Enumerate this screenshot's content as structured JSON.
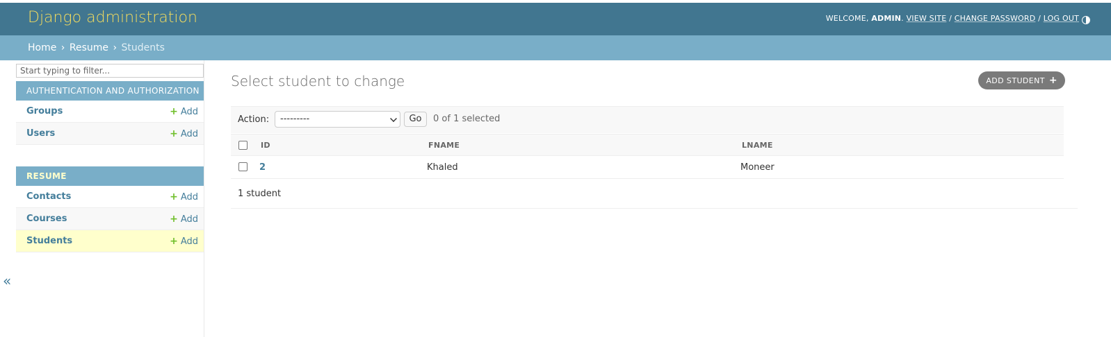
{
  "header": {
    "brand": "Django administration",
    "welcome": "WELCOME,",
    "username": "ADMIN",
    "view_site": "VIEW SITE",
    "change_password": "CHANGE PASSWORD",
    "log_out": "LOG OUT",
    "sep": "/"
  },
  "breadcrumbs": {
    "home": "Home",
    "app": "Resume",
    "current": "Students",
    "sep": "›"
  },
  "sidebar": {
    "filter_placeholder": "Start typing to filter...",
    "modules": [
      {
        "caption": "AUTHENTICATION AND AUTHORIZATION",
        "models": [
          {
            "name": "Groups",
            "add": "Add"
          },
          {
            "name": "Users",
            "add": "Add"
          }
        ]
      },
      {
        "caption": "RESUME",
        "models": [
          {
            "name": "Contacts",
            "add": "Add"
          },
          {
            "name": "Courses",
            "add": "Add"
          },
          {
            "name": "Students",
            "add": "Add"
          }
        ]
      }
    ],
    "collapse_glyph": "«"
  },
  "main": {
    "title": "Select student to change",
    "add_button": "ADD STUDENT",
    "actions": {
      "label": "Action:",
      "selected_option": "---------",
      "go": "Go",
      "count": "0 of 1 selected"
    },
    "table": {
      "columns": [
        "ID",
        "FNAME",
        "LNAME"
      ],
      "rows": [
        {
          "id": "2",
          "fname": "Khaled",
          "lname": "Moneer"
        }
      ]
    },
    "paginator": "1 student"
  },
  "icons": {
    "plus": "+",
    "theme_toggle": "half-circle-icon"
  },
  "colors": {
    "header_bg": "#417690",
    "brand": "#f5dd5d",
    "breadcrumbs_bg": "#79aec8",
    "link": "#447e9b",
    "add_green": "#70bf2b",
    "current_row": "#ffffcc"
  }
}
